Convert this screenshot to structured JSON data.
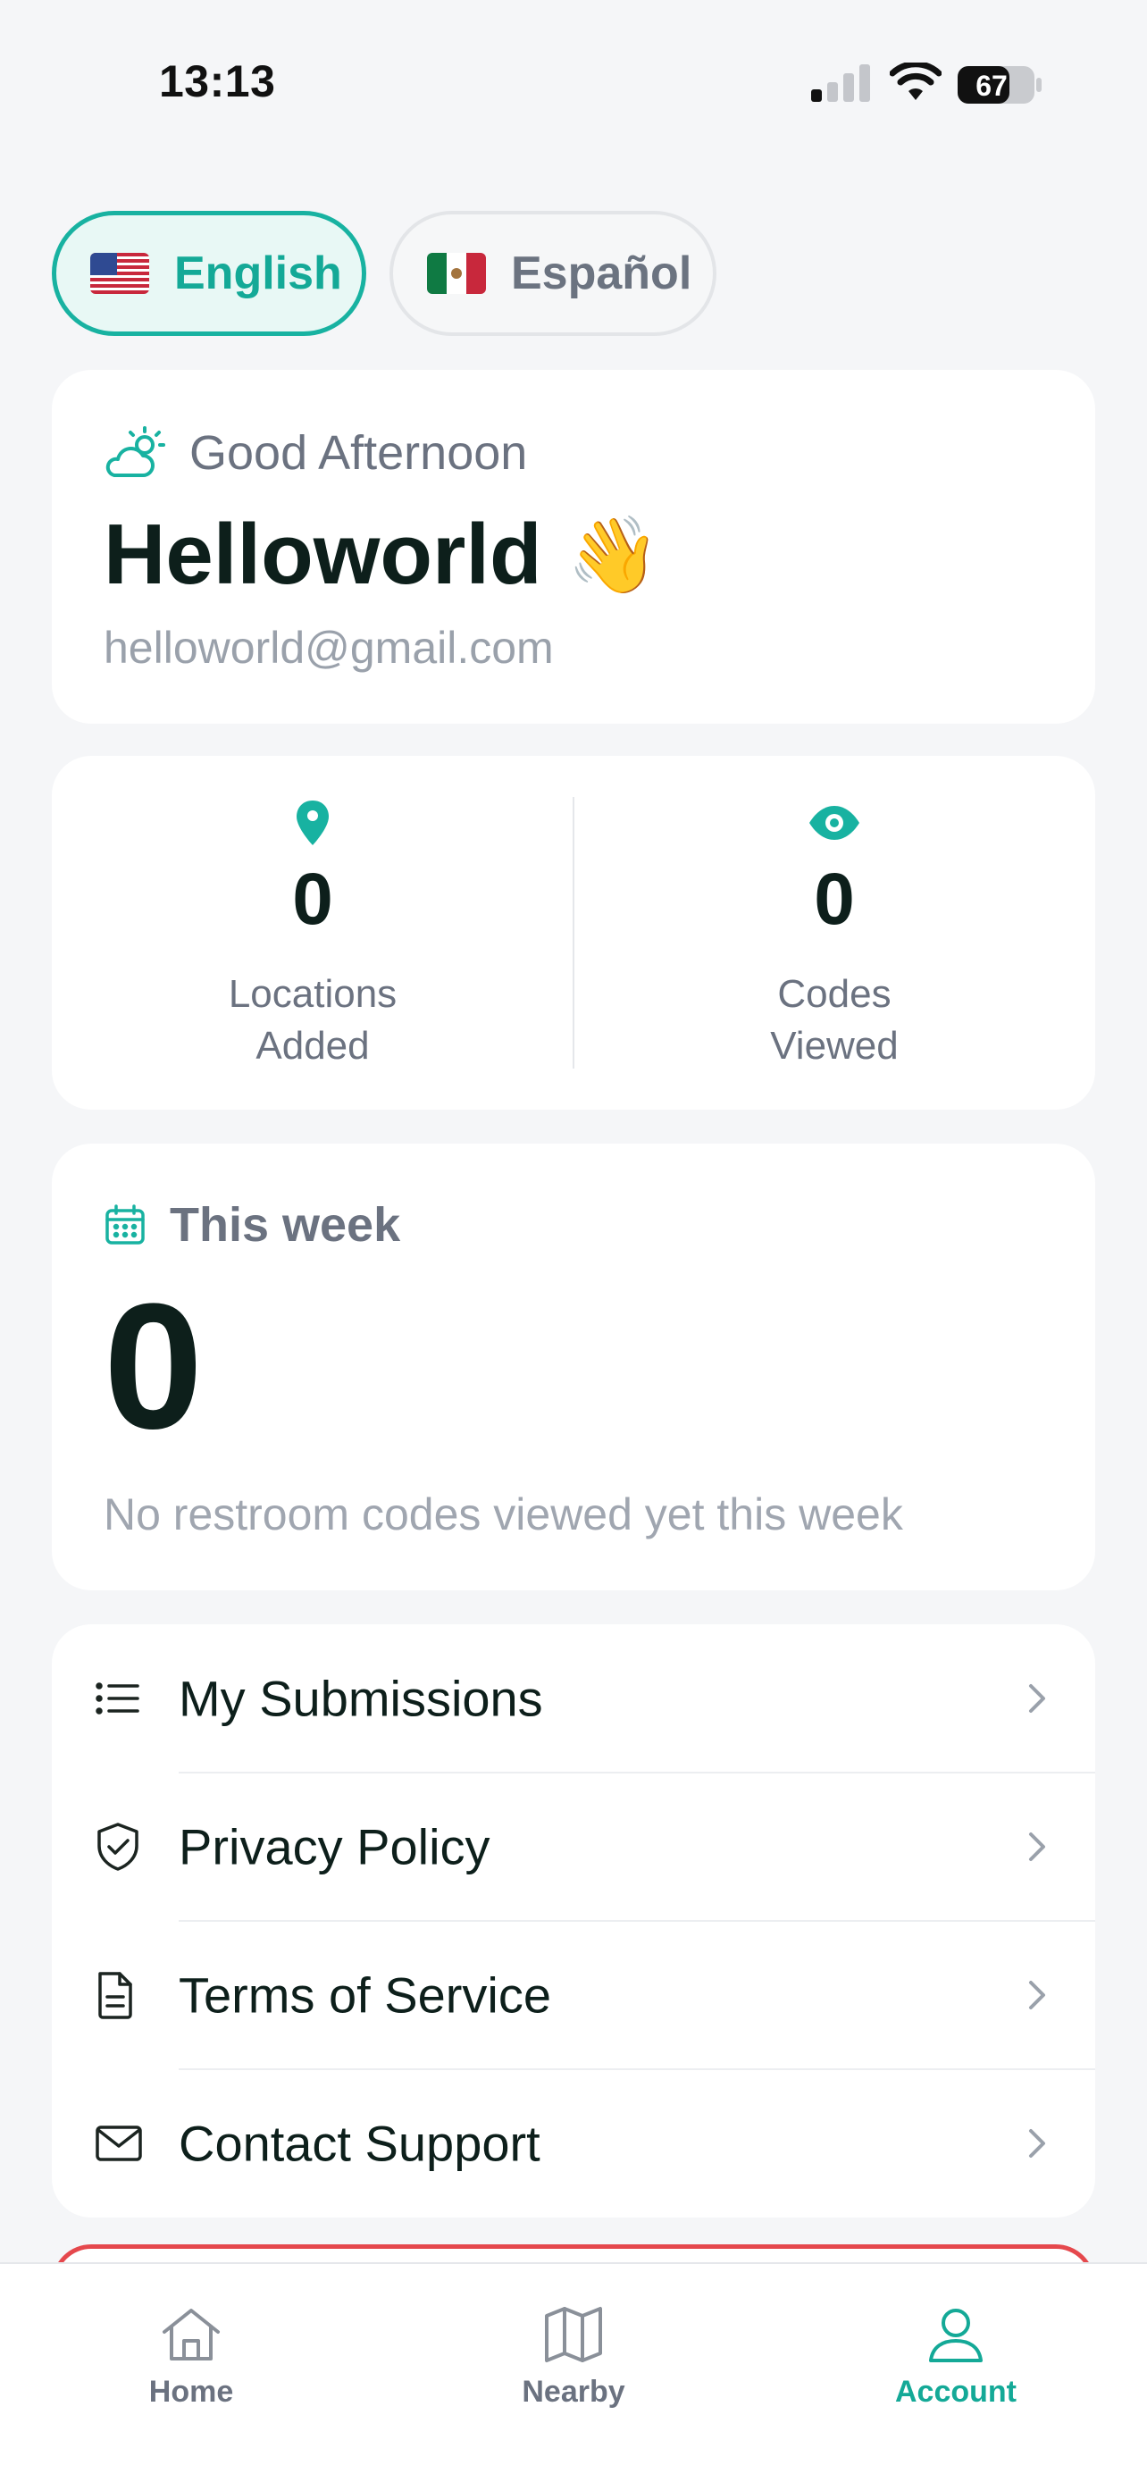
{
  "status_bar": {
    "time": "13:13",
    "battery": "67"
  },
  "language": {
    "options": [
      {
        "label": "English",
        "flag": "us-flag",
        "selected": true
      },
      {
        "label": "Español",
        "flag": "mx-flag",
        "selected": false
      }
    ]
  },
  "greeting": {
    "salutation": "Good Afternoon",
    "name": "Helloworld",
    "wave_emoji": "👋",
    "email": "helloworld@gmail.com"
  },
  "stats": {
    "locations": {
      "value": "0",
      "label_line1": "Locations",
      "label_line2": "Added"
    },
    "codes": {
      "value": "0",
      "label_line1": "Codes",
      "label_line2": "Viewed"
    }
  },
  "week": {
    "title": "This week",
    "count": "0",
    "note": "No restroom codes viewed yet this week"
  },
  "menu": {
    "items": [
      {
        "label": "My Submissions",
        "icon": "list-icon"
      },
      {
        "label": "Privacy Policy",
        "icon": "shield-check-icon"
      },
      {
        "label": "Terms of Service",
        "icon": "document-icon"
      },
      {
        "label": "Contact Support",
        "icon": "mail-icon"
      }
    ]
  },
  "tabs": {
    "items": [
      {
        "label": "Home",
        "icon": "home-icon",
        "active": false
      },
      {
        "label": "Nearby",
        "icon": "map-icon",
        "active": false
      },
      {
        "label": "Account",
        "icon": "user-icon",
        "active": true
      }
    ]
  },
  "colors": {
    "accent": "#14a997",
    "accent_bg": "#e8f8f5",
    "danger": "#e5484d",
    "text_primary": "#0d1f1b",
    "text_secondary": "#6b7280",
    "background": "#f5f6f8"
  }
}
